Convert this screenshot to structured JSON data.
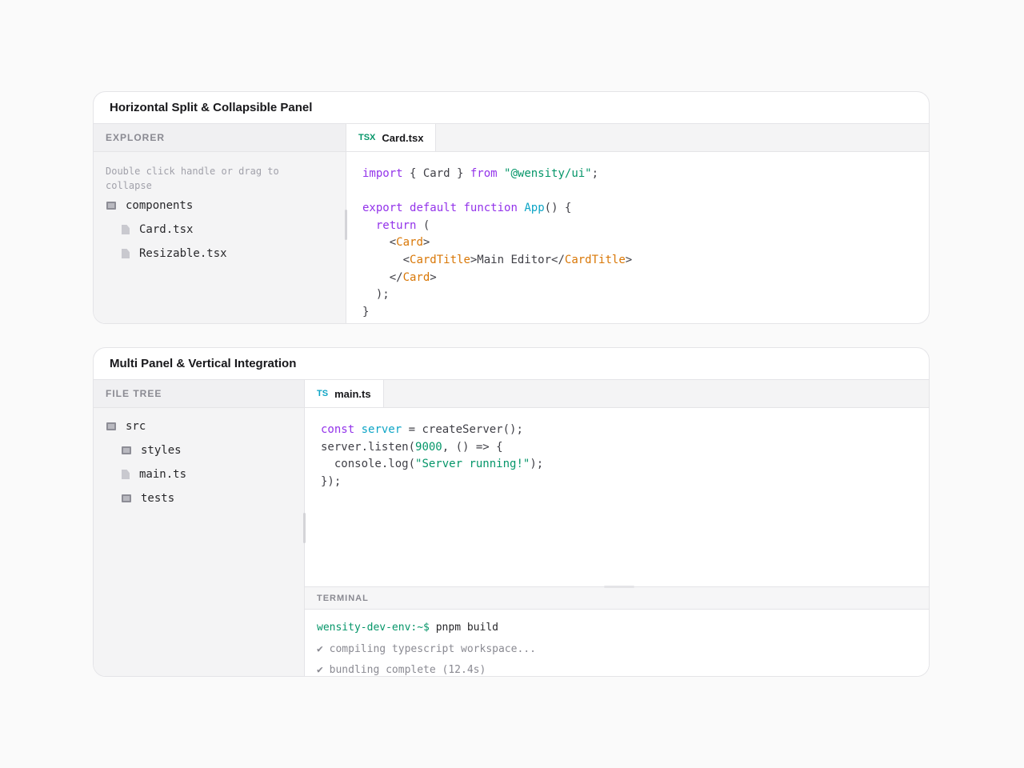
{
  "card1": {
    "title": "Horizontal Split & Collapsible Panel",
    "sidebar": {
      "header": "EXPLORER",
      "hint": "Double click handle or drag to collapse",
      "items": [
        {
          "label": "components",
          "kind": "folder",
          "icon": "folder-icon"
        },
        {
          "label": "Card.tsx",
          "kind": "file",
          "icon": "file-icon"
        },
        {
          "label": "Resizable.tsx",
          "kind": "file",
          "icon": "file-icon"
        }
      ]
    },
    "tab": {
      "lang": "TSX",
      "name": "Card.tsx",
      "lang_color": "#059669"
    }
  },
  "card2": {
    "title": "Multi Panel & Vertical Integration",
    "sidebar": {
      "header": "FILE TREE",
      "items": [
        {
          "label": "src",
          "kind": "folder",
          "icon": "folder-icon"
        },
        {
          "label": "styles",
          "kind": "folder",
          "icon": "folder-icon"
        },
        {
          "label": "main.ts",
          "kind": "file",
          "icon": "file-icon"
        },
        {
          "label": "tests",
          "kind": "folder",
          "icon": "folder-icon"
        }
      ]
    },
    "tab": {
      "lang": "TS",
      "name": "main.ts",
      "lang_color": "#0ea5c6"
    },
    "terminal": {
      "header": "TERMINAL",
      "prompt": "wensity-dev-env:~$",
      "command": " pnpm build",
      "lines": [
        "✔ compiling typescript workspace...",
        "✔ bundling complete (12.4s)"
      ]
    }
  },
  "code1": [
    [
      [
        "kw",
        "import"
      ],
      [
        "p",
        " { Card } "
      ],
      [
        "kw",
        "from"
      ],
      [
        "p",
        " "
      ],
      [
        "str",
        "\"@wensity/ui\""
      ],
      [
        "p",
        ";"
      ]
    ],
    [],
    [
      [
        "kw",
        "export"
      ],
      [
        "p",
        " "
      ],
      [
        "kw",
        "default"
      ],
      [
        "p",
        " "
      ],
      [
        "kw",
        "function"
      ],
      [
        "p",
        " "
      ],
      [
        "fn",
        "App"
      ],
      [
        "p",
        "() {"
      ]
    ],
    [
      [
        "p",
        "  "
      ],
      [
        "kw",
        "return"
      ],
      [
        "p",
        " ("
      ]
    ],
    [
      [
        "p",
        "    <"
      ],
      [
        "tag",
        "Card"
      ],
      [
        "p",
        ">"
      ]
    ],
    [
      [
        "p",
        "      <"
      ],
      [
        "tag",
        "CardTitle"
      ],
      [
        "p",
        ">Main Editor</"
      ],
      [
        "tag",
        "CardTitle"
      ],
      [
        "p",
        ">"
      ]
    ],
    [
      [
        "p",
        "    </"
      ],
      [
        "tag",
        "Card"
      ],
      [
        "p",
        ">"
      ]
    ],
    [
      [
        "p",
        "  );"
      ]
    ],
    [
      [
        "p",
        "}"
      ]
    ]
  ],
  "code2": [
    [
      [
        "kw",
        "const"
      ],
      [
        "p",
        " "
      ],
      [
        "fn",
        "server"
      ],
      [
        "p",
        " = createServer();"
      ]
    ],
    [
      [
        "p",
        "server.listen("
      ],
      [
        "num",
        "9000"
      ],
      [
        "p",
        ", () => {"
      ]
    ],
    [
      [
        "p",
        "  console.log("
      ],
      [
        "str",
        "\"Server running!\""
      ],
      [
        "p",
        ");"
      ]
    ],
    [
      [
        "p",
        "});"
      ]
    ]
  ],
  "colors": {
    "keyword": "#9333ea",
    "function": "#0ea5c6",
    "string": "#059669",
    "jsx_tag": "#d97706",
    "prompt": "#059669"
  }
}
